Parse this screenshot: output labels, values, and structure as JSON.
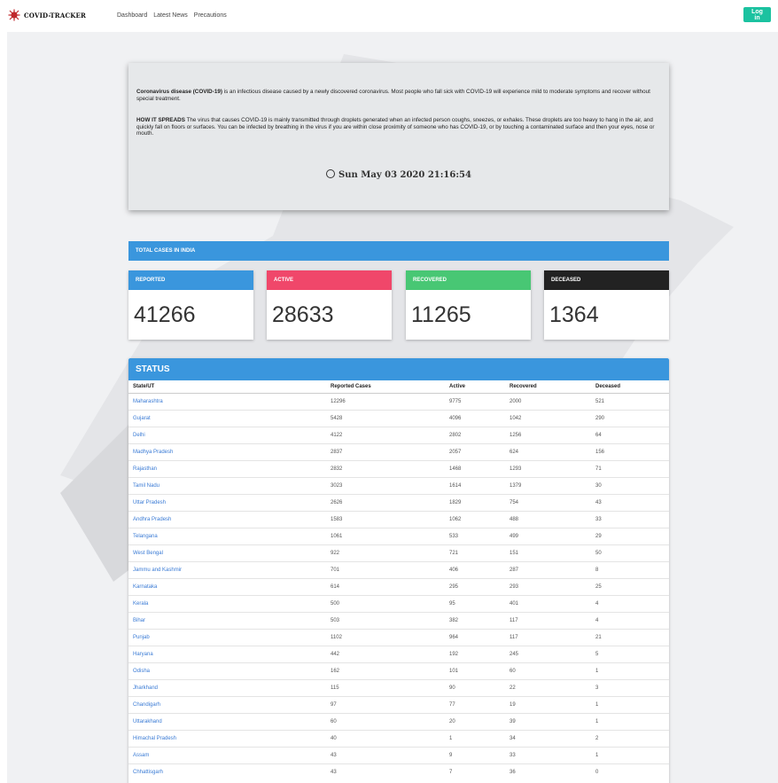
{
  "nav": {
    "brand": "COVID-TRACKER",
    "links": [
      "Dashboard",
      "Latest News",
      "Precautions"
    ],
    "login": "Log in"
  },
  "info": {
    "p1_bold": "Coronavirus disease (COVID-19)",
    "p1_rest": " is an infectious disease caused by a newly discovered coronavirus. Most people who fall sick with COVID-19 will experience mild to moderate symptoms and recover without special treatment.",
    "p2_bold": "HOW IT SPREADS",
    "p2_rest": " The virus that causes COVID-19 is mainly transmitted through droplets generated when an infected person coughs, sneezes, or exhales. These droplets are too heavy to hang in the air, and quickly fall on floors or surfaces. You can be infected by breathing in the virus if you are within close proximity of someone who has COVID-19, or by touching a contaminated surface and then your eyes, nose or mouth.",
    "datetime": "Sun May 03 2020 21:16:54"
  },
  "totals": {
    "title": "TOTAL CASES IN INDIA",
    "cards": [
      {
        "label": "REPORTED",
        "value": "41266",
        "color": "#3a96dd"
      },
      {
        "label": "ACTIVE",
        "value": "28633",
        "color": "#f0476a"
      },
      {
        "label": "RECOVERED",
        "value": "11265",
        "color": "#48c774"
      },
      {
        "label": "DECEASED",
        "value": "1364",
        "color": "#222222"
      }
    ]
  },
  "status": {
    "title": "STATUS",
    "headers": [
      "State/UT",
      "Reported Cases",
      "Active",
      "Recovered",
      "Deceased"
    ],
    "rows": [
      [
        "Maharashtra",
        "12296",
        "9775",
        "2000",
        "521"
      ],
      [
        "Gujarat",
        "5428",
        "4096",
        "1042",
        "290"
      ],
      [
        "Delhi",
        "4122",
        "2802",
        "1256",
        "64"
      ],
      [
        "Madhya Pradesh",
        "2837",
        "2057",
        "624",
        "156"
      ],
      [
        "Rajasthan",
        "2832",
        "1468",
        "1293",
        "71"
      ],
      [
        "Tamil Nadu",
        "3023",
        "1614",
        "1379",
        "30"
      ],
      [
        "Uttar Pradesh",
        "2626",
        "1829",
        "754",
        "43"
      ],
      [
        "Andhra Pradesh",
        "1583",
        "1062",
        "488",
        "33"
      ],
      [
        "Telangana",
        "1061",
        "533",
        "499",
        "29"
      ],
      [
        "West Bengal",
        "922",
        "721",
        "151",
        "50"
      ],
      [
        "Jammu and Kashmir",
        "701",
        "406",
        "287",
        "8"
      ],
      [
        "Karnataka",
        "614",
        "295",
        "293",
        "25"
      ],
      [
        "Kerala",
        "500",
        "95",
        "401",
        "4"
      ],
      [
        "Bihar",
        "503",
        "382",
        "117",
        "4"
      ],
      [
        "Punjab",
        "1102",
        "964",
        "117",
        "21"
      ],
      [
        "Haryana",
        "442",
        "192",
        "245",
        "5"
      ],
      [
        "Odisha",
        "162",
        "101",
        "60",
        "1"
      ],
      [
        "Jharkhand",
        "115",
        "90",
        "22",
        "3"
      ],
      [
        "Chandigarh",
        "97",
        "77",
        "19",
        "1"
      ],
      [
        "Uttarakhand",
        "60",
        "20",
        "39",
        "1"
      ],
      [
        "Himachal Pradesh",
        "40",
        "1",
        "34",
        "2"
      ],
      [
        "Assam",
        "43",
        "9",
        "33",
        "1"
      ],
      [
        "Chhattisgarh",
        "43",
        "7",
        "36",
        "0"
      ]
    ]
  }
}
